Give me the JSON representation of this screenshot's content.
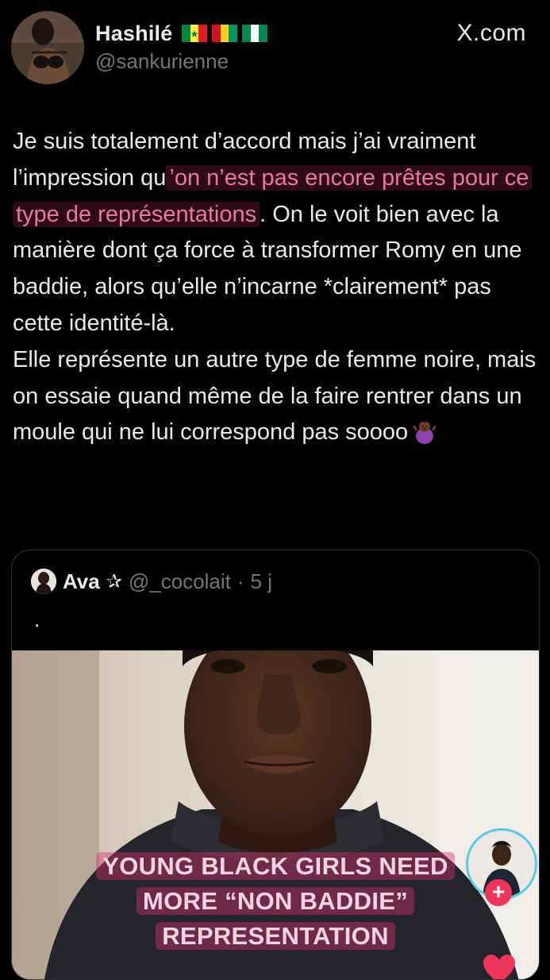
{
  "header": {
    "display_name": "Hashilé",
    "handle": "@sankurienne",
    "brand": "X.com",
    "flags": [
      "senegal-flag",
      "guinea-flag",
      "nigeria-flag"
    ]
  },
  "post": {
    "lines": [
      {
        "before": "Je suis totalement d’accord mais j’ai vraiment l’impression qu",
        "highlight": "’on n’est pas encore prêtes pour ce type de représentations",
        "after": ". On le voit bien avec la manière dont ça force  à transformer Romy en une baddie, alors qu’elle n’incarne *clairement* pas cette identité-là."
      },
      {
        "text": "Elle représente un autre type de femme noire, mais on essaie quand même de la faire rentrer dans un moule qui ne lui correspond pas soooo",
        "emoji": "woman-shrugging-emoji"
      }
    ]
  },
  "quote": {
    "name": "Ava",
    "star": "✰",
    "handle": "@_cocolait",
    "separator": "·",
    "time": "5 j",
    "text": ".",
    "caption_lines": [
      "YOUNG BLACK GIRLS NEED",
      "MORE “NON BADDIE”",
      "REPRESENTATION"
    ],
    "follow_symbol": "+"
  },
  "colors": {
    "background": "#000000",
    "text": "#e7e9ea",
    "muted": "#71767b",
    "highlight_text": "#e8789f",
    "highlight_bg": "#d6336c",
    "caption_text": "#f5d3df",
    "follow_red": "#f0365a"
  }
}
